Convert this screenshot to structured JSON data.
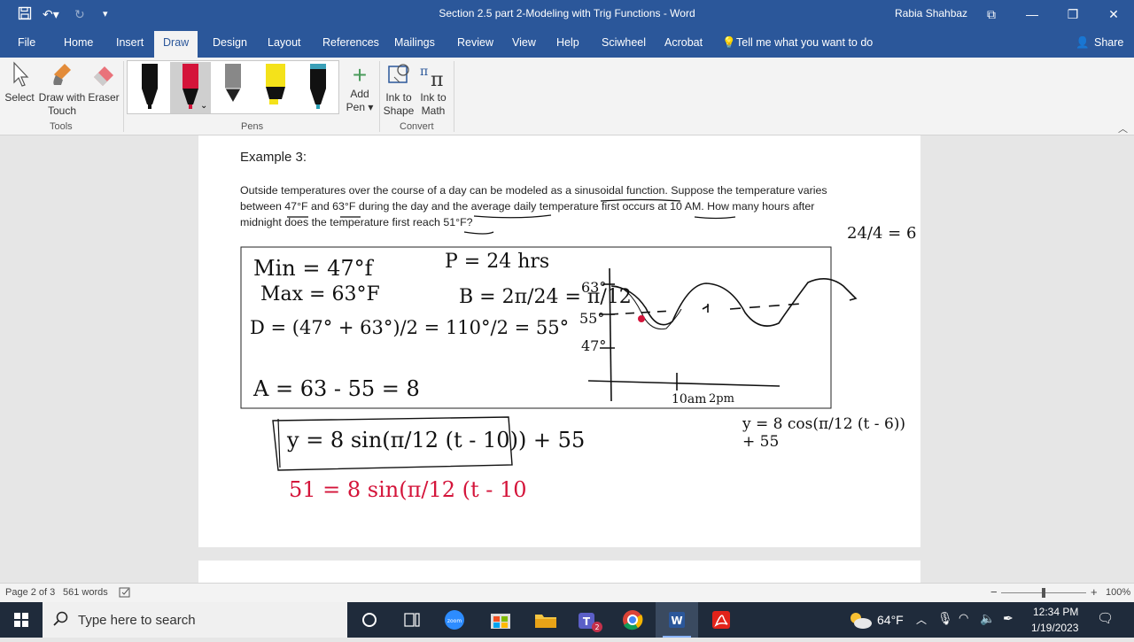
{
  "window": {
    "title": "Section 2.5 part 2-Modeling with Trig Functions  -  Word",
    "user": "Rabia Shahbaz"
  },
  "tabs": [
    "File",
    "Home",
    "Insert",
    "Draw",
    "Design",
    "Layout",
    "References",
    "Mailings",
    "Review",
    "View",
    "Help",
    "Sciwheel",
    "Acrobat"
  ],
  "tell_me": "Tell me what you want to do",
  "share": "Share",
  "ribbon": {
    "tools": {
      "select": "Select",
      "draw_with": "Draw with",
      "touch": "Touch",
      "eraser": "Eraser",
      "label": "Tools"
    },
    "pens_label": "Pens",
    "add": "Add",
    "pen": "Pen",
    "convert": {
      "ink_to": "Ink to",
      "shape": "Shape",
      "math": "Math",
      "label": "Convert"
    }
  },
  "document": {
    "heading": "Example 3:",
    "line1": "Outside temperatures over the course of a day can be modeled as a sinusoidal function. Suppose the temperature varies",
    "line2": "between 47°F and 63°F during the day and the average daily temperature first occurs at 10 AM. How many hours after",
    "line3": "midnight does the temperature first reach 51°F?",
    "ink": {
      "min": "Min = 47°f",
      "max": "Max = 63°F",
      "d": "D = (47° + 63°)/2 = 110°/2 = 55°",
      "a": "A = 63 - 55 = 8",
      "p": "P = 24 hrs",
      "b": "B = 2π/24 = π/12",
      "side": "24/4 = 6",
      "g63": "63°",
      "g55": "55°",
      "g47": "47°",
      "g10am": "10am",
      "g2pm": "2pm",
      "eq1": "y = 8 sin(π/12 (t - 10)) + 55",
      "eq2": "y = 8 cos(π/12 (t - 6)) + 55",
      "eq3": "51 = 8 sin(π/12 (t - 10"
    }
  },
  "status": {
    "page": "Page 2 of 3",
    "words": "561 words",
    "zoom": "100%"
  },
  "taskbar": {
    "search_placeholder": "Type here to search",
    "weather": "64°F",
    "time": "12:34 PM",
    "date": "1/19/2023"
  },
  "colors": {
    "accent": "#2b579a",
    "ink": "#111111",
    "red_ink": "#d4143a"
  }
}
